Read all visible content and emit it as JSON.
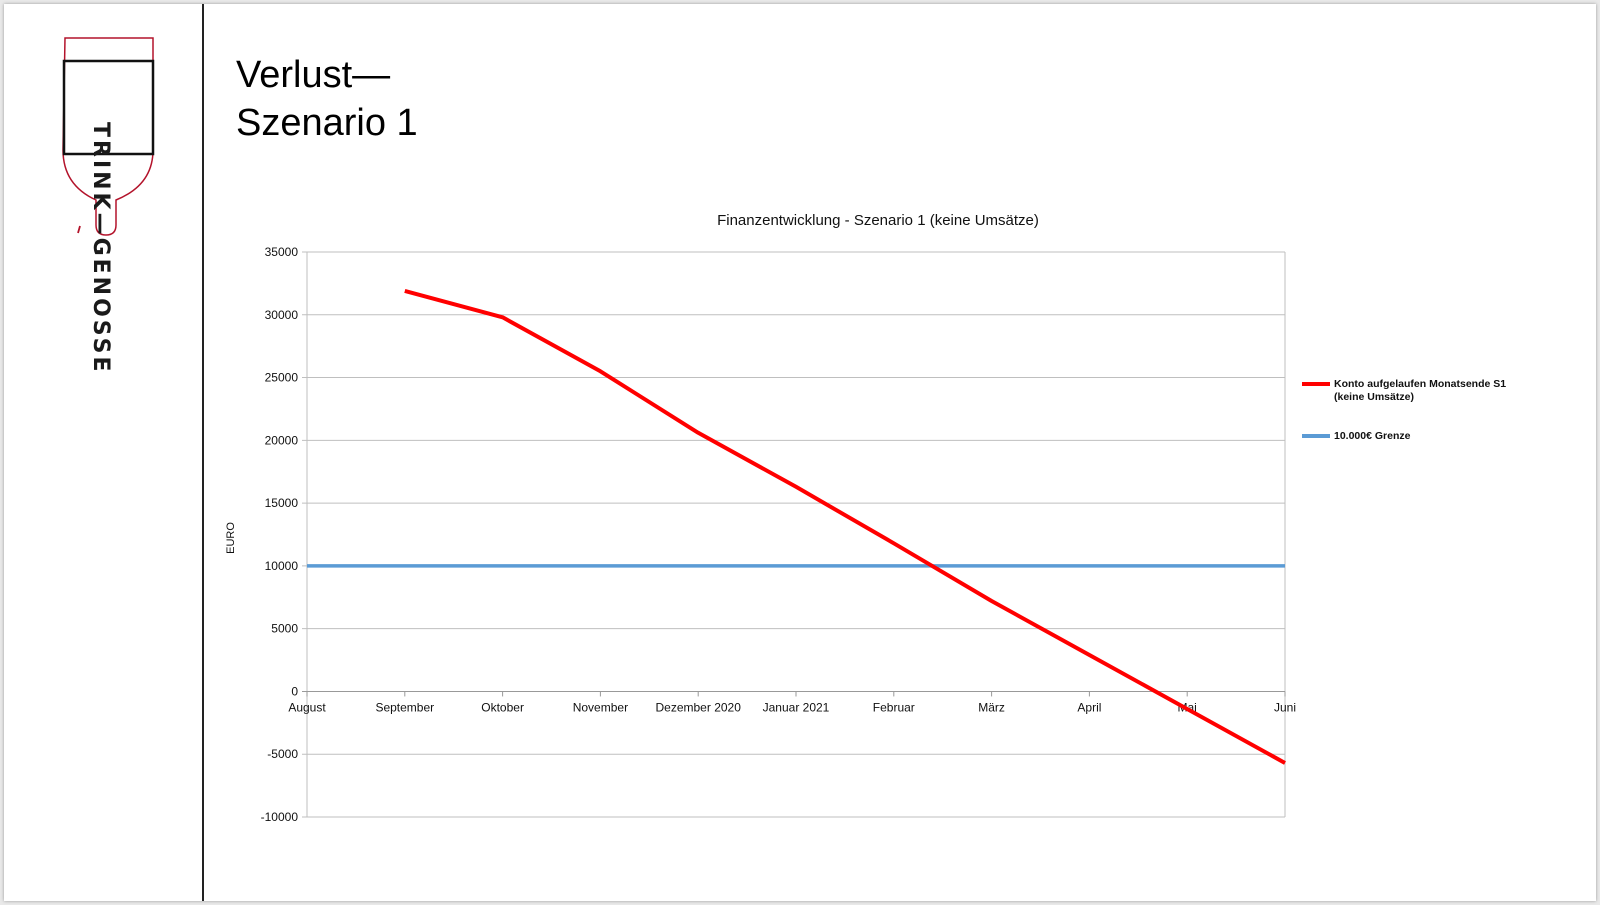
{
  "slide": {
    "title_line1": "Verlust—",
    "title_line2": "Szenario 1",
    "logo_text": "TRINK—GENOSSE"
  },
  "colors": {
    "series_konto": "#ff0000",
    "series_grenze": "#5b9bd5",
    "gridline": "#bfbfbf",
    "logo_sketch": "#b3132b"
  },
  "chart_data": {
    "type": "line",
    "title": "Finanzentwicklung - Szenario 1 (keine Umsätze)",
    "xlabel": "",
    "ylabel": "EURO",
    "categories": [
      "August",
      "September",
      "Oktober",
      "November",
      "Dezember 2020",
      "Januar 2021",
      "Februar",
      "März",
      "April",
      "Mai",
      "Juni"
    ],
    "ylim": [
      -10000,
      35000
    ],
    "yticks": [
      35000,
      30000,
      25000,
      20000,
      15000,
      10000,
      5000,
      0,
      -5000,
      -10000
    ],
    "grid": true,
    "legend_position": "right",
    "series": [
      {
        "name": "Konto aufgelaufen Monatsende S1 (keine Umsätze)",
        "color": "#ff0000",
        "values": [
          null,
          31900,
          29800,
          25500,
          20600,
          16300,
          11800,
          7200,
          2900,
          -1400,
          -5700
        ]
      },
      {
        "name": "10.000€ Grenze",
        "color": "#5b9bd5",
        "values": [
          10000,
          10000,
          10000,
          10000,
          10000,
          10000,
          10000,
          10000,
          10000,
          10000,
          10000
        ]
      }
    ],
    "legend": [
      {
        "line1": "Konto aufgelaufen Monatsende S1",
        "line2": "(keine Umsätze)"
      },
      {
        "line1": "10.000€ Grenze",
        "line2": ""
      }
    ]
  }
}
